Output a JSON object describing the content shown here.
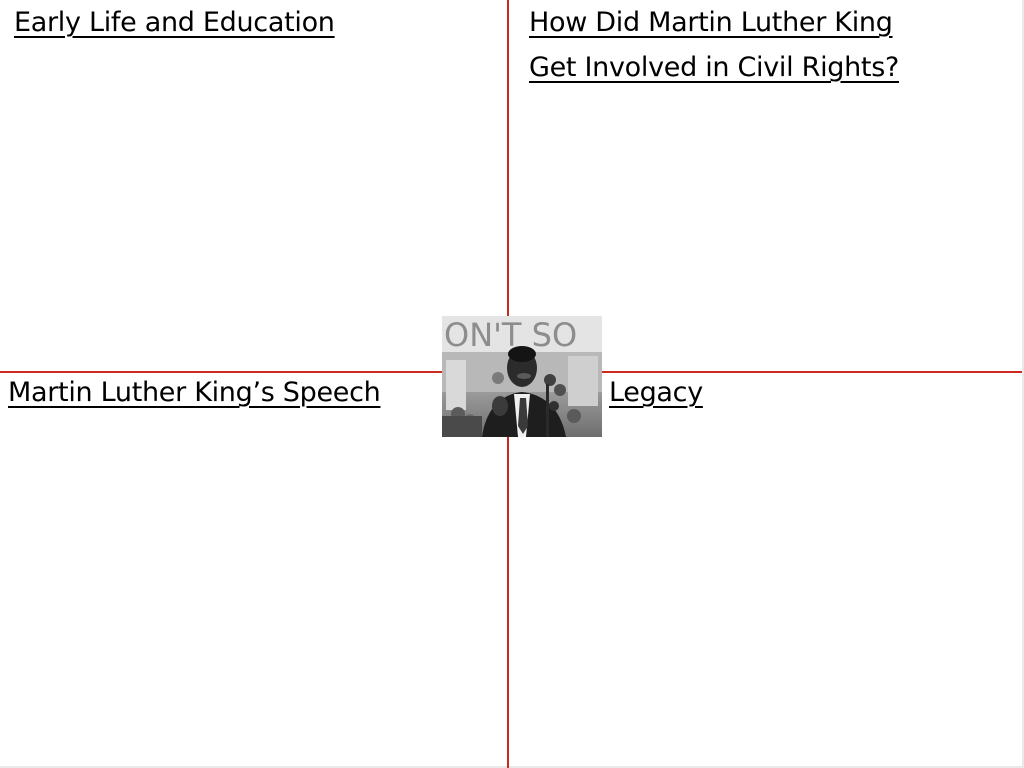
{
  "quadrants": {
    "top_left": {
      "heading": "Early Life and Education"
    },
    "top_right": {
      "heading_line1": "How Did Martin Luther King",
      "heading_line2": "Get Involved in Civil Rights?"
    },
    "bottom_left": {
      "heading": "Martin Luther King’s Speech"
    },
    "bottom_right": {
      "heading": "Legacy"
    }
  },
  "photo": {
    "sign_text": "ON'T SO",
    "tone": "grayscale"
  },
  "colors": {
    "background": "#ffffff",
    "divider": "#cc2a1e",
    "text": "#000000"
  }
}
